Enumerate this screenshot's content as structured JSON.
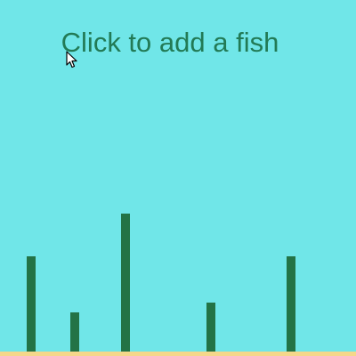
{
  "scene": {
    "prompt": "Click to add a fish",
    "cursor_icon": "arrow-pointer-icon"
  },
  "colors": {
    "water": "#70e6e8",
    "text": "#227a55",
    "seaweed": "#237346",
    "sand": "#f5d78a"
  }
}
